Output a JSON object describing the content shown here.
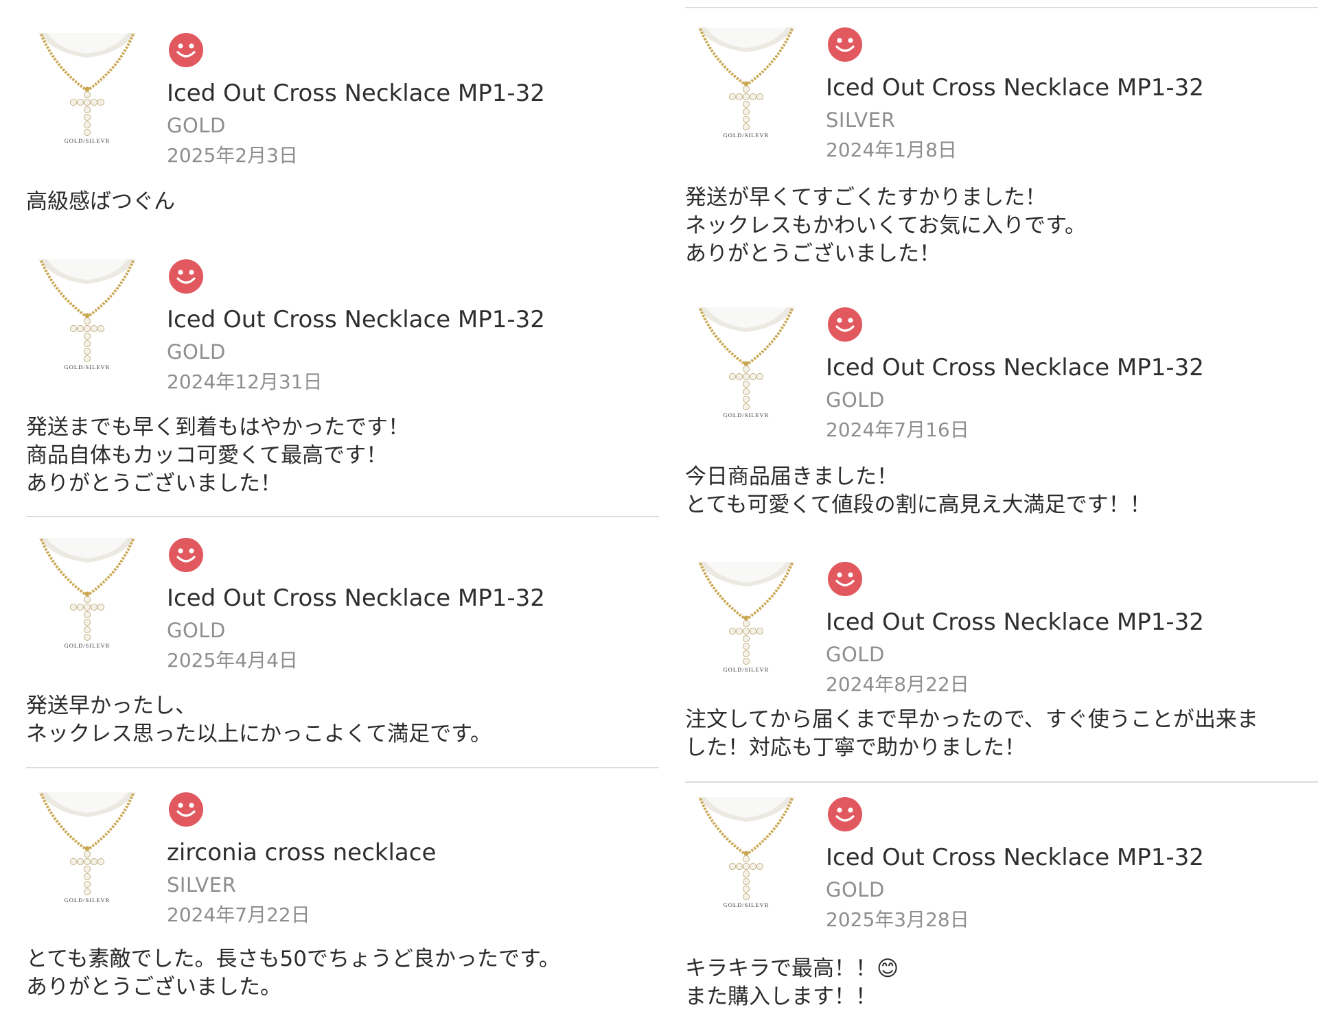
{
  "reviews": [
    {
      "product": "Iced Out Cross Necklace MP1-32",
      "variant": "GOLD",
      "date": "2025年2月3日",
      "comment": "高級感ばつぐん",
      "thumb_caption": "GOLD/SILEVR",
      "rating_icon": "smile-face-icon"
    },
    {
      "product": "Iced Out Cross Necklace MP1-32",
      "variant": "GOLD",
      "date": "2024年12月31日",
      "comment": "発送までも早く到着もはやかったです！\n商品自体もカッコ可愛くて最高です！\nありがとうございました！",
      "thumb_caption": "GOLD/SILEVR",
      "rating_icon": "smile-face-icon"
    },
    {
      "product": "Iced Out Cross Necklace MP1-32",
      "variant": "GOLD",
      "date": "2025年4月4日",
      "comment": "発送早かったし、\nネックレス思った以上にかっこよくて満足です。",
      "thumb_caption": "GOLD/SILEVR",
      "rating_icon": "smile-face-icon"
    },
    {
      "product": "zirconia cross necklace",
      "variant": "SILVER",
      "date": "2024年7月22日",
      "comment": "とても素敵でした。長さも50でちょうど良かったです。\nありがとうございました。",
      "thumb_caption": "GOLD/SILEVR",
      "rating_icon": "smile-face-icon"
    },
    {
      "product": "Iced Out Cross Necklace MP1-32",
      "variant": "SILVER",
      "date": "2024年1月8日",
      "comment": "発送が早くてすごくたすかりました！\nネックレスもかわいくてお気に入りです。\nありがとうございました！",
      "thumb_caption": "GOLD/SILEVR",
      "rating_icon": "smile-face-icon"
    },
    {
      "product": "Iced Out Cross Necklace MP1-32",
      "variant": "GOLD",
      "date": "2024年7月16日",
      "comment": "今日商品届きました！\nとても可愛くて値段の割に高見え大満足です！！",
      "thumb_caption": "GOLD/SILEVR",
      "rating_icon": "smile-face-icon"
    },
    {
      "product": "Iced Out Cross Necklace MP1-32",
      "variant": "GOLD",
      "date": "2024年8月22日",
      "comment": "注文してから届くまで早かったので、すぐ使うことが出来ま\nした！対応も丁寧で助かりました！",
      "thumb_caption": "GOLD/SILEVR",
      "rating_icon": "smile-face-icon"
    },
    {
      "product": "Iced Out Cross Necklace MP1-32",
      "variant": "GOLD",
      "date": "2025年3月28日",
      "comment": "キラキラで最高！！😊\nまた購入します！！",
      "thumb_caption": "GOLD/SILEVR",
      "rating_icon": "smile-face-icon"
    }
  ],
  "colors": {
    "face": "#e2585f",
    "chain": "#c9a64f",
    "text_primary": "#2b2b2b",
    "text_secondary": "#8e8e8e",
    "divider": "#dcdcdc"
  }
}
